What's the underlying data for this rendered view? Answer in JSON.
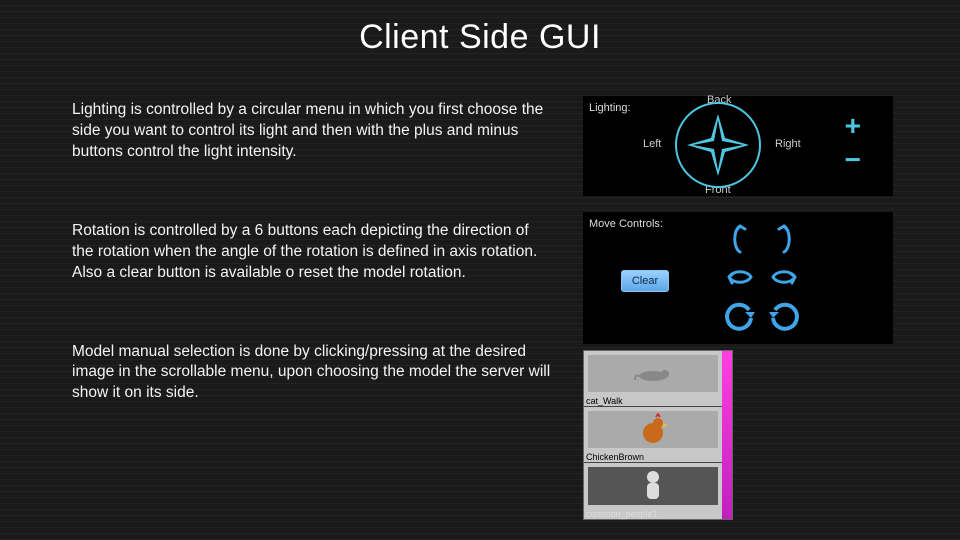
{
  "title": "Client Side GUI",
  "paragraphs": {
    "lighting": "Lighting is controlled by a circular menu in which you first choose the side you want to control its light and then with the plus and minus buttons control the light intensity.",
    "rotation": "Rotation is controlled by a 6 buttons each depicting the direction of the rotation when the angle of the rotation is defined in axis rotation. Also a clear button is available o reset the model rotation.",
    "selection": "Model manual selection is done by clicking/pressing at the desired image in the scrollable menu, upon choosing the model the server will show it on its side."
  },
  "lighting_panel": {
    "label": "Lighting:",
    "dirs": {
      "back": "Back",
      "left": "Left",
      "right": "Right",
      "front": "Front"
    },
    "plus": "+",
    "minus": "−"
  },
  "move_panel": {
    "label": "Move Controls:",
    "clear": "Clear"
  },
  "models": {
    "items": [
      {
        "name": "cat_Walk"
      },
      {
        "name": "ChickenBrown"
      },
      {
        "name": "common_people1"
      }
    ]
  }
}
